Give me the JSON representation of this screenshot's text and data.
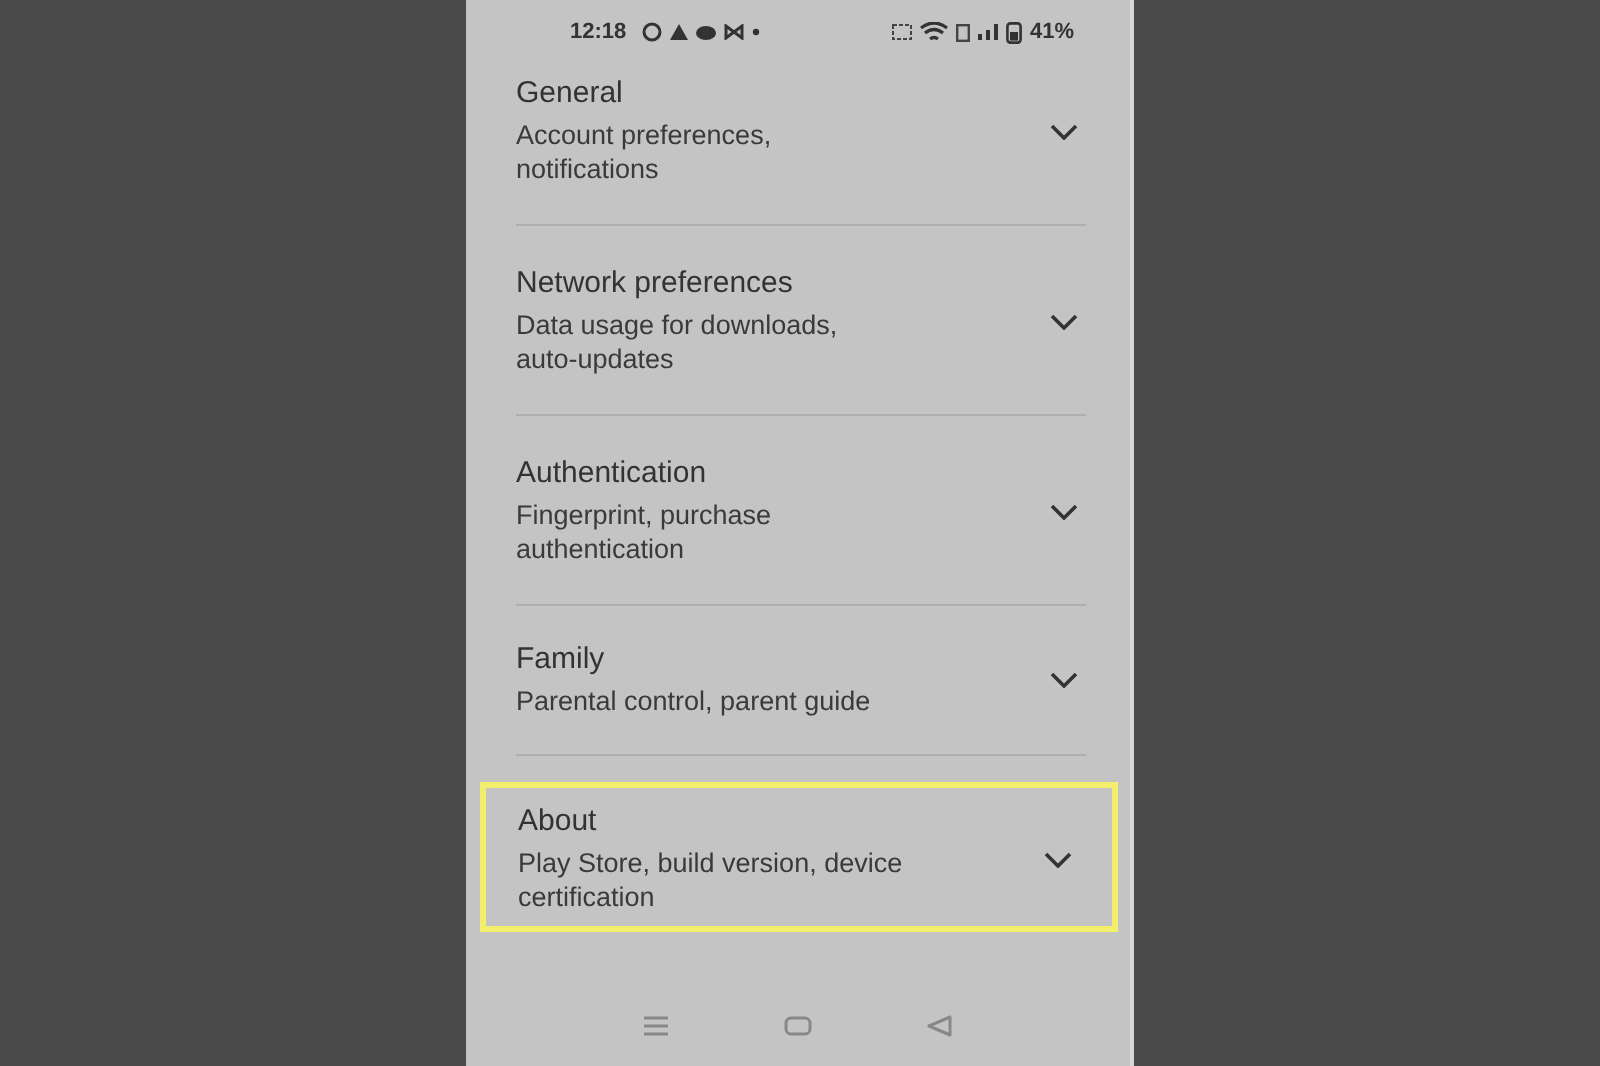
{
  "status_bar": {
    "time": "12:18",
    "battery": "41%"
  },
  "settings": [
    {
      "title": "General",
      "subtitle": "Account preferences, notifications",
      "highlighted": false
    },
    {
      "title": "Network preferences",
      "subtitle": "Data usage for downloads, auto-updates",
      "highlighted": false
    },
    {
      "title": "Authentication",
      "subtitle": "Fingerprint, purchase authentication",
      "highlighted": false
    },
    {
      "title": "Family",
      "subtitle": "Parental control, parent guide",
      "highlighted": false
    },
    {
      "title": "About",
      "subtitle": "Play Store, build version, device certification",
      "highlighted": true
    }
  ]
}
